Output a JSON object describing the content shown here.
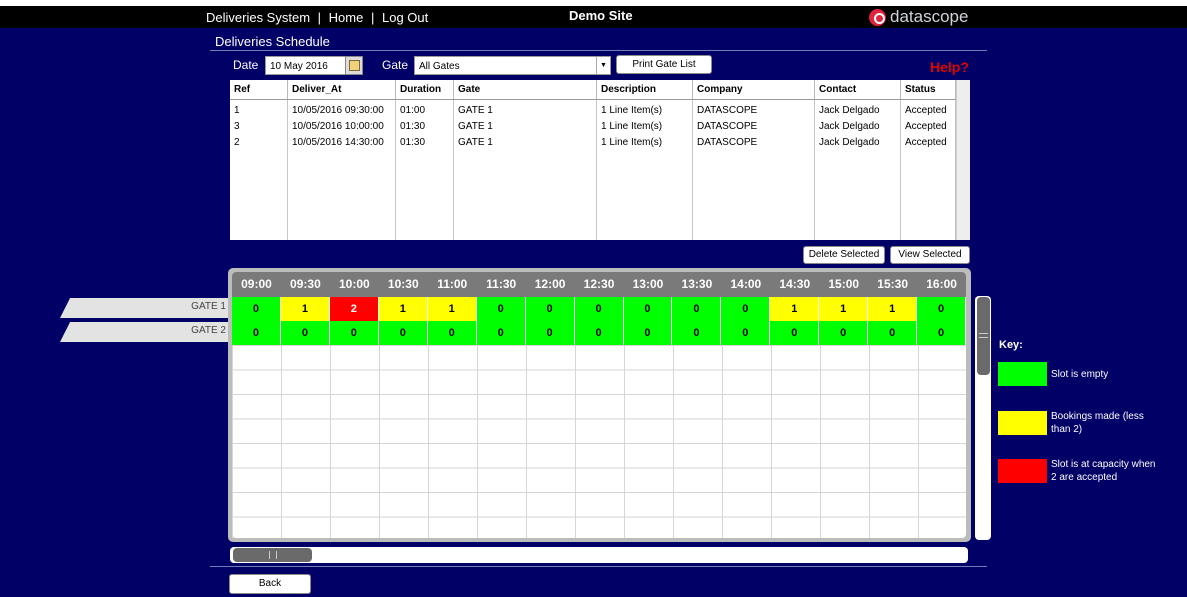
{
  "top_nav": {
    "system": "Deliveries System",
    "sep": "|",
    "home": "Home",
    "logout": "Log Out",
    "site": "Demo Site",
    "logo_text": "datascope",
    "logo_icon": "datascope-logo-icon"
  },
  "page": {
    "title": "Deliveries Schedule"
  },
  "filters": {
    "date_label": "Date",
    "date_value": "10 May 2016",
    "gate_label": "Gate",
    "gate_value": "All Gates",
    "print_label": "Print Gate List",
    "help_label": "Help?"
  },
  "table": {
    "headers": [
      "Ref",
      "Deliver_At",
      "Duration",
      "Gate",
      "Description",
      "Company",
      "Contact",
      "Status"
    ],
    "rows": [
      [
        "1",
        "10/05/2016 09:30:00",
        "01:00",
        "GATE 1",
        "1 Line Item(s)",
        "DATASCOPE",
        "Jack Delgado",
        "Accepted"
      ],
      [
        "3",
        "10/05/2016 10:00:00",
        "01:30",
        "GATE 1",
        "1 Line Item(s)",
        "DATASCOPE",
        "Jack Delgado",
        "Accepted"
      ],
      [
        "2",
        "10/05/2016 14:30:00",
        "01:30",
        "GATE 1",
        "1 Line Item(s)",
        "DATASCOPE",
        "Jack Delgado",
        "Accepted"
      ]
    ],
    "delete_label": "Delete Selected",
    "view_label": "View Selected"
  },
  "schedule": {
    "times": [
      "09:00",
      "09:30",
      "10:00",
      "10:30",
      "11:00",
      "11:30",
      "12:00",
      "12:30",
      "13:00",
      "13:30",
      "14:00",
      "14:30",
      "15:00",
      "15:30",
      "16:00"
    ],
    "gates": [
      {
        "name": "GATE 1",
        "slots": [
          "0",
          "1",
          "2",
          "1",
          "1",
          "0",
          "0",
          "0",
          "0",
          "0",
          "0",
          "1",
          "1",
          "1",
          "0"
        ],
        "states": [
          "g",
          "y",
          "r",
          "y",
          "y",
          "g",
          "g",
          "g",
          "g",
          "g",
          "g",
          "y",
          "y",
          "y",
          "g"
        ]
      },
      {
        "name": "GATE 2",
        "slots": [
          "0",
          "0",
          "0",
          "0",
          "0",
          "0",
          "0",
          "0",
          "0",
          "0",
          "0",
          "0",
          "0",
          "0",
          "0"
        ],
        "states": [
          "g",
          "g",
          "g",
          "g",
          "g",
          "g",
          "g",
          "g",
          "g",
          "g",
          "g",
          "g",
          "g",
          "g",
          "g"
        ]
      }
    ]
  },
  "key": {
    "title": "Key:",
    "items": [
      {
        "color": "#00ff00",
        "text": "Slot is empty"
      },
      {
        "color": "#ffff00",
        "text": "Bookings made (less than 2)"
      },
      {
        "color": "#ff0000",
        "text": "Slot is at capacity when 2 are accepted"
      }
    ]
  },
  "footer": {
    "back_label": "Back"
  }
}
